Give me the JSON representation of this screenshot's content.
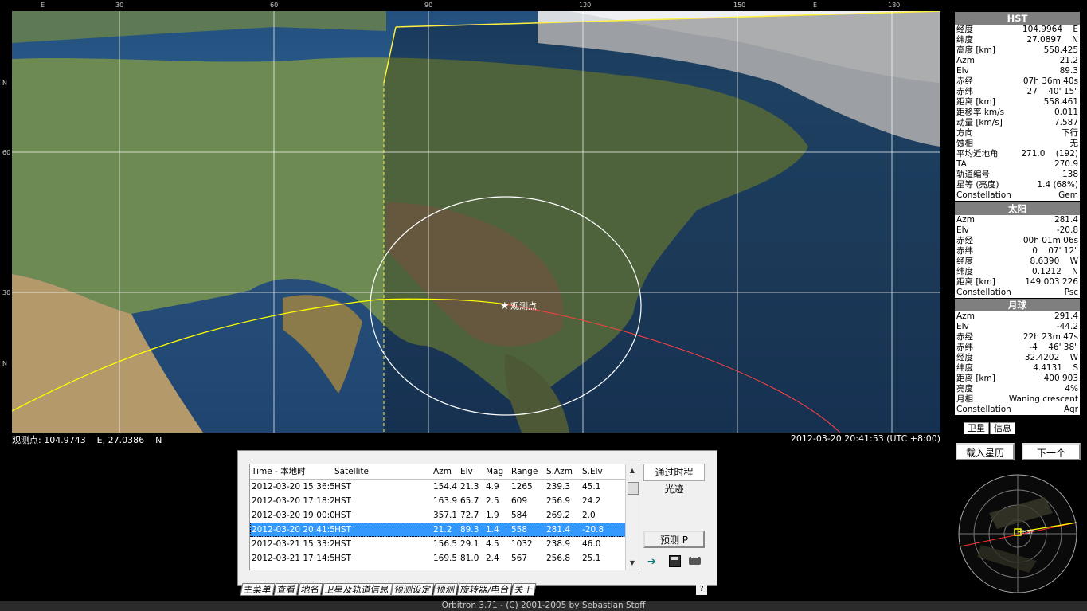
{
  "app": {
    "status_text": "Orbitron 3.71 - (C) 2001-2005 by Sebastian Stoff"
  },
  "map": {
    "top_ticks": [
      "E",
      "30",
      "60",
      "90",
      "120",
      "150",
      "E",
      "180"
    ],
    "side_labels": [
      "N",
      "60",
      "30",
      "N"
    ],
    "observer_label": "观测点",
    "observer_line": "观测点: 104.9743    E, 27.0386    N",
    "datetime": "2012-03-20 20:41:53 (UTC +8:00)"
  },
  "panel_hst": {
    "title": "HST",
    "rows": [
      {
        "k": "经度",
        "v": "104.9964    E"
      },
      {
        "k": "纬度",
        "v": "27.0897    N"
      },
      {
        "k": "高度 [km]",
        "v": "558.425"
      },
      {
        "k": "Azm",
        "v": "21.2"
      },
      {
        "k": "Elv",
        "v": "89.3"
      },
      {
        "k": "赤经",
        "v": "07h 36m 40s"
      },
      {
        "k": "赤纬",
        "v": "27    40' 15\""
      },
      {
        "k": "距离 [km]",
        "v": "558.461"
      },
      {
        "k": "距移率 km/s",
        "v": "0.011"
      },
      {
        "k": "动量 [km/s]",
        "v": "7.587"
      },
      {
        "k": "方向",
        "v": "下行"
      },
      {
        "k": "蚀相",
        "v": "无"
      },
      {
        "k": "平均近地角",
        "v": "271.0    (192)"
      },
      {
        "k": "TA",
        "v": "270.9"
      },
      {
        "k": "轨道编号",
        "v": "138"
      },
      {
        "k": "星等 (亮度)",
        "v": "1.4 (68%)"
      },
      {
        "k": "Constellation",
        "v": "Gem"
      }
    ]
  },
  "panel_sun": {
    "title": "太阳",
    "rows": [
      {
        "k": "Azm",
        "v": "281.4"
      },
      {
        "k": "Elv",
        "v": "-20.8"
      },
      {
        "k": "赤经",
        "v": "00h 01m 06s"
      },
      {
        "k": "赤纬",
        "v": "0    07' 12\""
      },
      {
        "k": "经度",
        "v": "8.6390    W"
      },
      {
        "k": "纬度",
        "v": "0.1212    N"
      },
      {
        "k": "距离 [km]",
        "v": "149 003 226"
      },
      {
        "k": "Constellation",
        "v": "Psc"
      }
    ]
  },
  "panel_moon": {
    "title": "月球",
    "rows": [
      {
        "k": "Azm",
        "v": "291.4"
      },
      {
        "k": "Elv",
        "v": "-44.2"
      },
      {
        "k": "赤经",
        "v": "22h 23m 47s"
      },
      {
        "k": "赤纬",
        "v": "-4    46' 38\""
      },
      {
        "k": "经度",
        "v": "32.4202    W"
      },
      {
        "k": "纬度",
        "v": "4.4131    S"
      },
      {
        "k": "距离 [km]",
        "v": "400 903"
      },
      {
        "k": "亮度",
        "v": "4%"
      },
      {
        "k": "月相",
        "v": "Waning crescent"
      },
      {
        "k": "Constellation",
        "v": "Aqr"
      }
    ]
  },
  "panel_tabs": [
    "卫星",
    "信息"
  ],
  "right_buttons": {
    "load": "载入星历",
    "next": "下一个"
  },
  "radar": {
    "sat_label": "HST"
  },
  "predict": {
    "headers": [
      "Time - 本地时",
      "Satellite",
      "Azm",
      "Elv",
      "Mag",
      "Range",
      "S.Azm",
      "S.Elv"
    ],
    "rows": [
      [
        "2012-03-20 15:36:57",
        "HST",
        "154.4",
        "21.3",
        "4.9",
        "1265",
        "239.3",
        "45.1"
      ],
      [
        "2012-03-20 17:18:22",
        "HST",
        "163.9",
        "65.7",
        "2.5",
        "609",
        "256.9",
        "24.2"
      ],
      [
        "2012-03-20 19:00:05",
        "HST",
        "357.1",
        "72.7",
        "1.9",
        "584",
        "269.2",
        "2.0"
      ],
      [
        "2012-03-20 20:41:53",
        "HST",
        "21.2",
        "89.3",
        "1.4",
        "558",
        "281.4",
        "-20.8"
      ],
      [
        "2012-03-21 15:33:22",
        "HST",
        "156.5",
        "29.1",
        "4.5",
        "1032",
        "238.9",
        "46.0"
      ],
      [
        "2012-03-21 17:14:51",
        "HST",
        "169.5",
        "81.0",
        "2.4",
        "567",
        "256.8",
        "25.1"
      ]
    ],
    "selected_index": 3,
    "btn_pass": "通过时程",
    "btn_track": "光迹",
    "btn_predict": "预测 P"
  },
  "bottom_tabs": [
    "主菜单",
    "查看",
    "地名",
    "卫星及轨道信息",
    "预测设定",
    "预测",
    "旋转器/电台",
    "关于"
  ],
  "help_label": "?"
}
